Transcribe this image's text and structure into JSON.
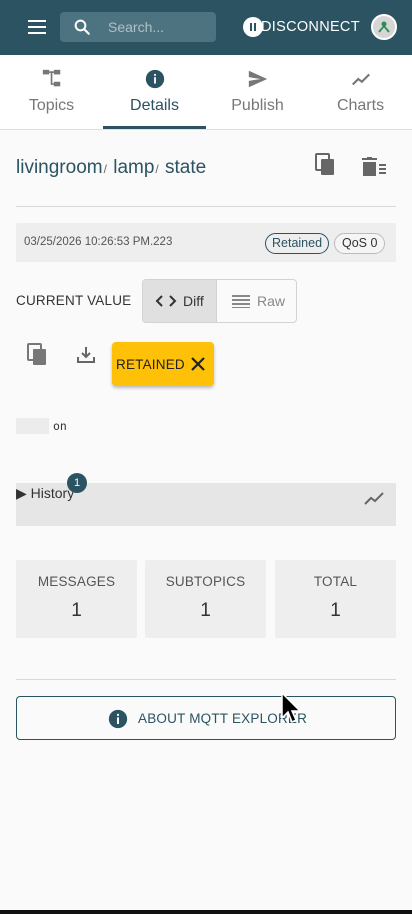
{
  "appbar": {
    "search_placeholder": "Search...",
    "disconnect_label": "DISCONNECT",
    "colors": {
      "primary": "#2b5361"
    }
  },
  "tabs": [
    {
      "label": "Topics",
      "icon": "topics-tree-icon"
    },
    {
      "label": "Details",
      "icon": "info-icon",
      "active": true
    },
    {
      "label": "Publish",
      "icon": "send-icon"
    },
    {
      "label": "Charts",
      "icon": "chart-line-icon"
    }
  ],
  "topic": {
    "segments": [
      "livingroom",
      "lamp",
      "state"
    ],
    "separator": "/"
  },
  "meta": {
    "timestamp": "03/25/2026 10:26:53 PM.223",
    "retained_chip": "Retained",
    "qos_chip": "QoS 0"
  },
  "current_value": {
    "label": "CURRENT VALUE",
    "diff_label": "Diff",
    "raw_label": "Raw",
    "retained_button": "RETAINED",
    "value": "on"
  },
  "history": {
    "label": "History",
    "count": "1"
  },
  "stats": [
    {
      "label": "MESSAGES",
      "value": "1"
    },
    {
      "label": "SUBTOPICS",
      "value": "1"
    },
    {
      "label": "TOTAL",
      "value": "1"
    }
  ],
  "about_label": "ABOUT MQTT EXPLORER"
}
